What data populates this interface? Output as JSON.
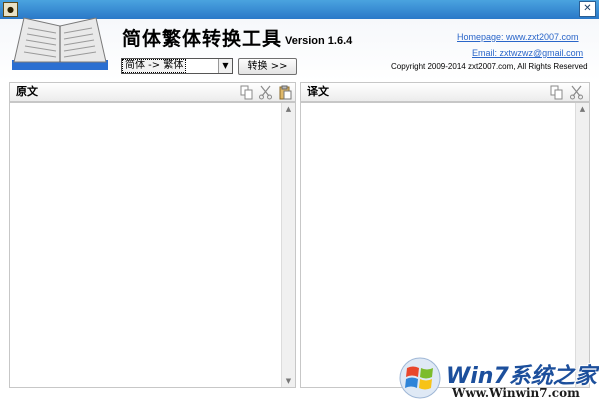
{
  "titlebar": {
    "app_icon_label": "●",
    "close_label": "✕"
  },
  "header": {
    "title": "简体繁体转换工具",
    "version": "Version 1.6.4",
    "homepage": "Homepage: www.zxt2007.com",
    "email": "Email: zxtwzwz@gmail.com",
    "copyright": "Copyright 2009-2014 zxt2007.com, All Rights Reserved"
  },
  "controls": {
    "mode_select_value": "简体 -> 繁体",
    "convert_button": "转换 >>"
  },
  "panels": {
    "source": {
      "title": "原文",
      "tools": [
        "copy-icon",
        "cut-icon",
        "paste-icon"
      ]
    },
    "target": {
      "title": "译文",
      "tools": [
        "copy-icon",
        "cut-icon"
      ]
    }
  },
  "watermark": {
    "brand": "Win7系统之家",
    "url": "Www.Winwin7.com"
  }
}
